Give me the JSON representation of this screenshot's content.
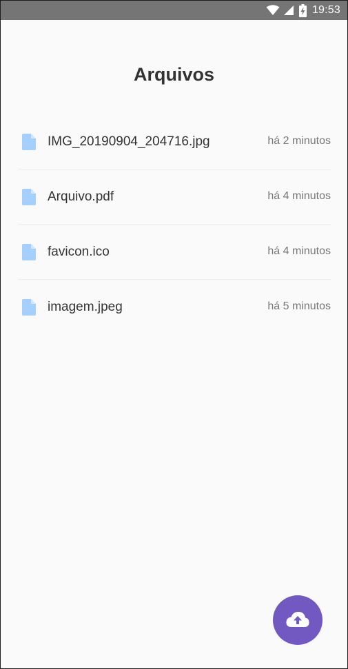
{
  "status_bar": {
    "time": "19:53",
    "icons": [
      "wifi-icon",
      "signal-icon",
      "battery-charging-icon"
    ]
  },
  "page": {
    "title": "Arquivos"
  },
  "files": [
    {
      "name": "IMG_20190904_204716.jpg",
      "time": "há 2 minutos",
      "icon": "file-icon"
    },
    {
      "name": "Arquivo.pdf",
      "time": "há 4 minutos",
      "icon": "file-icon"
    },
    {
      "name": "favicon.ico",
      "time": "há 4 minutos",
      "icon": "file-icon"
    },
    {
      "name": "imagem.jpeg",
      "time": "há 5 minutos",
      "icon": "file-icon"
    }
  ],
  "fab": {
    "icon": "cloud-upload-icon"
  },
  "colors": {
    "status_bar": "#757575",
    "background": "#fafafa",
    "accent": "#7159c1",
    "file_icon": "#a5cfff",
    "title_text": "#333333",
    "secondary_text": "#777777"
  }
}
